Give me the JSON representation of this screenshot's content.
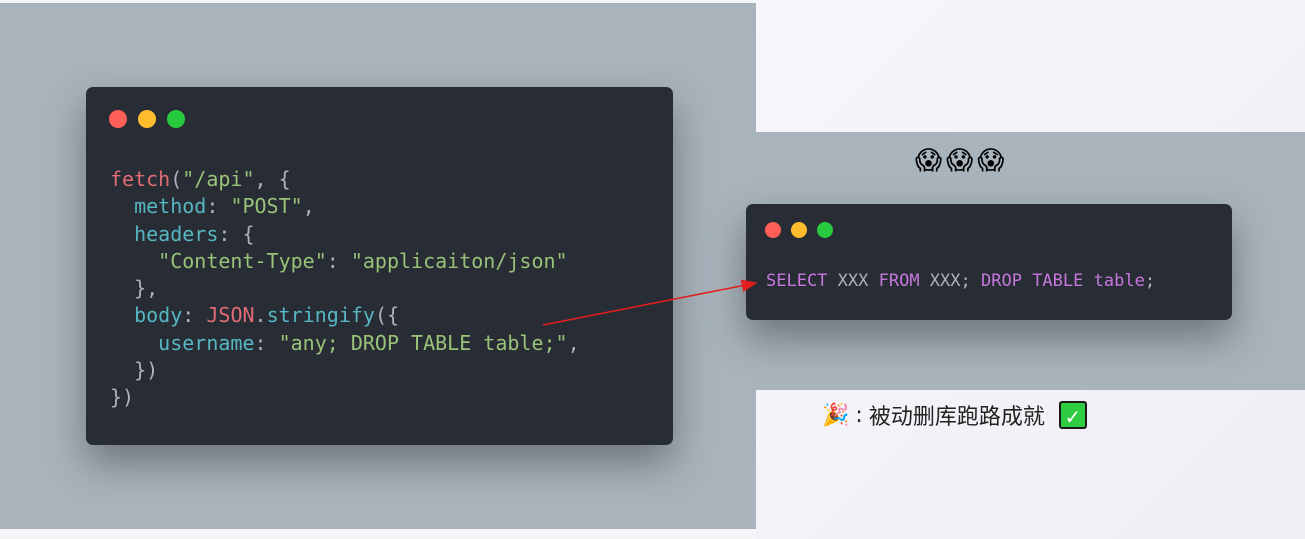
{
  "left_code": {
    "l1": {
      "fn": "fetch",
      "p1": "(",
      "str": "\"/api\"",
      "p2": ", {"
    },
    "l2": {
      "indent": "  ",
      "prop": "method",
      "colon": ": ",
      "str": "\"POST\"",
      "end": ","
    },
    "l3": {
      "indent": "  ",
      "prop": "headers",
      "colon": ": {"
    },
    "l4": {
      "indent": "    ",
      "str1": "\"Content-Type\"",
      "colon": ": ",
      "str2": "\"applicaiton/json\""
    },
    "l5": {
      "text": "  },"
    },
    "l6": {
      "indent": "  ",
      "prop": "body",
      "colon": ": ",
      "obj": "JSON",
      "dot": ".",
      "method": "stringify",
      "p": "({"
    },
    "l7": {
      "indent": "    ",
      "prop": "username",
      "colon": ": ",
      "str": "\"any; DROP TABLE table;\"",
      "end": ","
    },
    "l8": {
      "text": "  })"
    },
    "l9": {
      "text": "})"
    }
  },
  "sql": {
    "kw1": "SELECT",
    "t1": " XXX ",
    "kw2": "FROM",
    "t2": " XXX; ",
    "kw3": "DROP",
    "t3": " ",
    "kw4": "TABLE",
    "t4": " ",
    "kw5": "table",
    "t5": ";"
  },
  "emojis": "😱😱😱",
  "caption": {
    "party_emoji": "🎉",
    "colon": ":",
    "text": "被动删库跑路成就",
    "check": "✓"
  },
  "colors": {
    "panel_bg": "#a8b3bc",
    "window_bg": "#282c34",
    "arrow": "#e02020"
  }
}
